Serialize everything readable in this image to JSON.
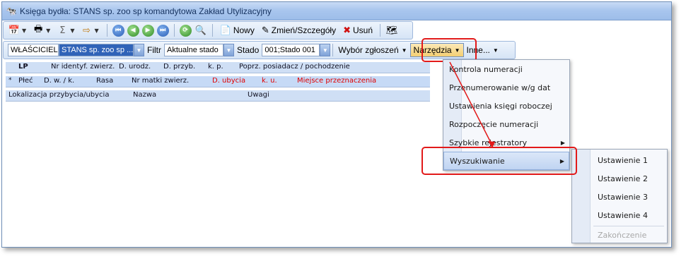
{
  "window": {
    "title": "Księga bydła: STANS sp. zoo sp komandytowa Zakład Utylizacyjny"
  },
  "toolbar1": {
    "nowy": "Nowy",
    "zmien": "Zmień/Szczegóły",
    "usun": "Usuń"
  },
  "toolbar2": {
    "owner_label": "WŁAŚCICIEL",
    "owner_value": "STANS sp. zoo sp ...",
    "filter_label": "Filtr",
    "filter_value": "Aktualne stado",
    "stado_label": "Stado",
    "stado_value": "001;Stado 001",
    "wybor": "Wybór zgłoszeń",
    "narzedzia": "Narzędzia",
    "inne": "Inne..."
  },
  "grid": {
    "row1": [
      "LP",
      "Nr identyf. zwierz.",
      "D. urodz.",
      "D. przyb.",
      "k. p.",
      "Poprz. posiadacz / pochodzenie"
    ],
    "row2_icon": "*",
    "row2": [
      "Płeć",
      "D. w. / k.",
      "Rasa",
      "Nr matki zwierz.",
      "D. ubycia",
      "k. u.",
      "Miejsce przeznaczenia"
    ],
    "row3": [
      "Lokalizacja przybycia/ubycia",
      "Nazwa",
      "Uwagi"
    ]
  },
  "menu_narzedzia": {
    "items": [
      "Kontrola numeracji",
      "Przenumerowanie w/g dat",
      "Ustawienia księgi roboczej",
      "Rozpoczęcie numeracji",
      "Szybkie rejestratory",
      "Wyszukiwanie"
    ]
  },
  "menu_wyszukiwanie": {
    "items": [
      "Ustawienie 1",
      "Ustawienie 2",
      "Ustawienie 3",
      "Ustawienie 4",
      "Zakończenie"
    ]
  },
  "colors": {
    "highlight": "#e21a1a",
    "accent": "#3063b8"
  }
}
